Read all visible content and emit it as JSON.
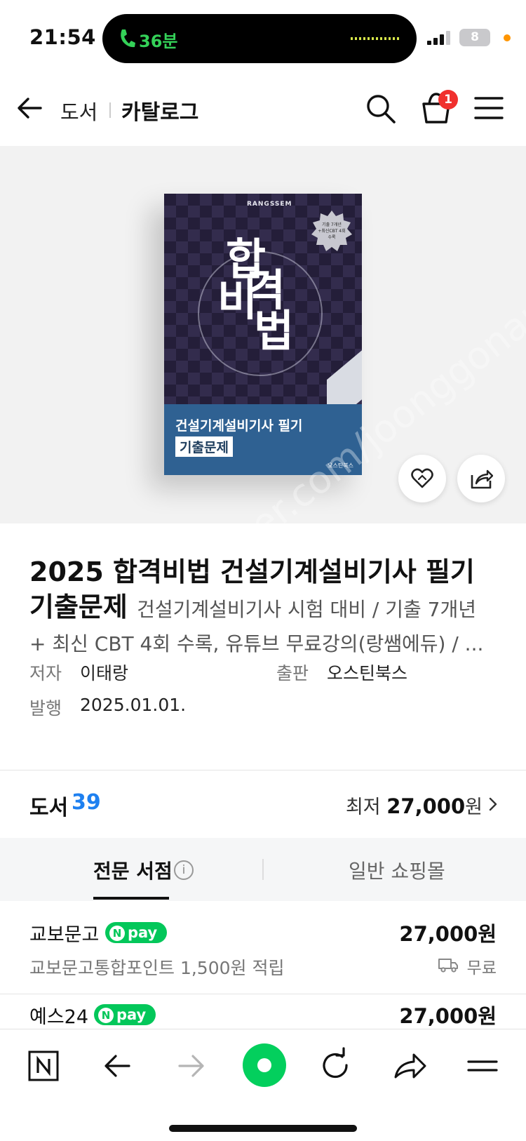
{
  "status": {
    "time": "21:54",
    "call": "36분",
    "battery": "8"
  },
  "header": {
    "category": "도서",
    "title": "카탈로그",
    "cart_count": "1"
  },
  "book_cover": {
    "brand": "RANGSSEM",
    "title_lines": [
      "합",
      "격",
      "비",
      "법"
    ],
    "seal": "기출 7개년 +최신CBT 4회 수록",
    "subtitle": "건설기계설비기사 필기",
    "tag": "기출문제",
    "publisher": "오스틴북스"
  },
  "watermark": "cafe.naver.com/joonggonara",
  "product": {
    "title_main": "2025 합격비법 건설기계설비기사 필기 기출문제",
    "title_sub": "건설기계설비기사 시험 대비 / 기출 7개년",
    "desc": "+ 최신 CBT 4회 수록, 유튜브 무료강의(랑쌤에듀) / ...",
    "author_label": "저자",
    "author": "이태랑",
    "publisher_label": "출판",
    "publisher": "오스틴북스",
    "date_label": "발행",
    "date": "2025.01.01."
  },
  "counts": {
    "label": "도서",
    "count": "39",
    "lowest_label": "최저",
    "lowest_price": "27,000",
    "won": "원"
  },
  "tabs": {
    "active": "전문 서점",
    "other": "일반 쇼핑몰"
  },
  "sellers": [
    {
      "name": "교보문고",
      "badge": "pay",
      "price": "27,000원",
      "point": "교보문고통합포인트 1,500원 적립",
      "ship": "무료"
    },
    {
      "name": "예스24",
      "badge": "pay",
      "price": "27,000원"
    }
  ],
  "colors": {
    "accent_blue": "#1e80f0",
    "npay_green": "#03c75a",
    "badge_red": "#f0302e"
  }
}
